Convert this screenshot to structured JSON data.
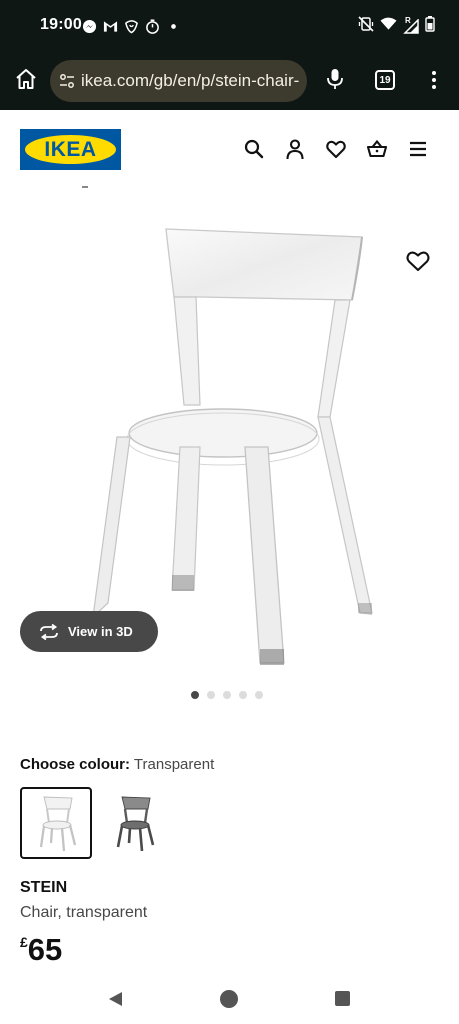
{
  "status_bar": {
    "time": "19:00",
    "left_icons": [
      "messenger-icon",
      "gmail-icon",
      "do-not-disturb-icon",
      "timer-icon",
      "dot-icon"
    ],
    "right_icons": [
      "mute-vibrate-icon",
      "wifi-icon",
      "signal-icon",
      "battery-icon"
    ],
    "signal_label": "R"
  },
  "browser": {
    "url": "ikea.com/gb/en/p/stein-chair-",
    "tab_count": "19"
  },
  "header": {
    "logo_text": "IKEA",
    "icons": [
      "search-icon",
      "account-icon",
      "heart-icon",
      "basket-icon",
      "hamburger-menu-icon"
    ]
  },
  "product": {
    "view_3d_label": "View in 3D",
    "image_count": 5,
    "active_image_index": 0,
    "colour_label": "Choose colour:",
    "colour_value": "Transparent",
    "swatches": [
      {
        "colour": "transparent",
        "selected": true
      },
      {
        "colour": "dark-grey",
        "selected": false
      }
    ],
    "name": "STEIN",
    "description": "Chair, transparent",
    "price_currency": "£",
    "price_value": "65"
  },
  "colors": {
    "status_bg": "#0f1715",
    "url_pill_bg": "#3d3a2e",
    "ikea_blue": "#0058a3",
    "ikea_yellow": "#ffdb00",
    "pill_button_bg": "#484848"
  }
}
